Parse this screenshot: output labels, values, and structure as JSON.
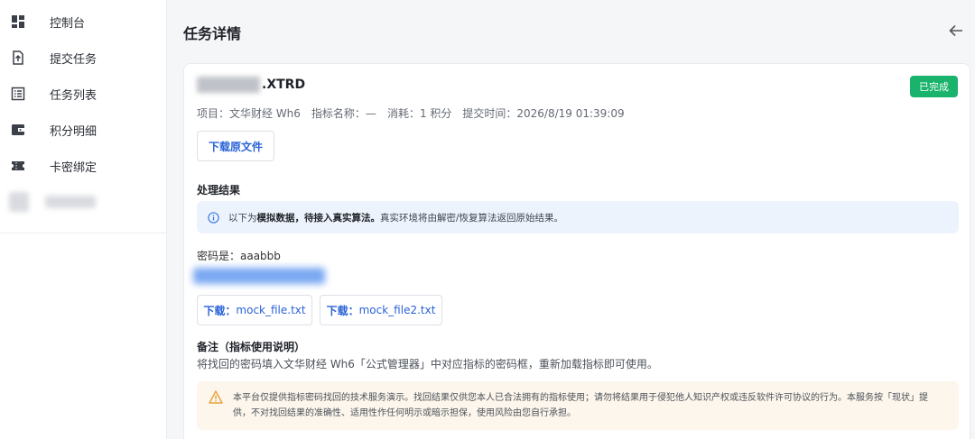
{
  "sidebar": {
    "items": [
      {
        "label": "控制台",
        "icon": "dashboard-icon"
      },
      {
        "label": "提交任务",
        "icon": "upload-file-icon"
      },
      {
        "label": "任务列表",
        "icon": "list-icon"
      },
      {
        "label": "积分明细",
        "icon": "wallet-icon"
      },
      {
        "label": "卡密绑定",
        "icon": "ticket-icon"
      }
    ]
  },
  "header": {
    "title": "任务详情",
    "back_icon": "arrow-left-icon"
  },
  "task": {
    "file_ext": ".XTRD",
    "status": "已完成",
    "meta": {
      "project": "项目：文华财经 Wh6",
      "indicator": "指标名称：—",
      "cost": "消耗：1 积分",
      "submit_time": "提交时间：2026/8/19 01:39:09"
    },
    "download_original": "下载原文件"
  },
  "result": {
    "title": "处理结果",
    "info": {
      "prefix": "以下为 ",
      "bold": "模拟数据，待接入真实算法。",
      "rest": "真实环境将由解密/恢复算法返回原始结果。"
    },
    "password_line": "密码是：aaabbb",
    "downloads": [
      {
        "prefix": "下载：",
        "file": "mock_file.txt"
      },
      {
        "prefix": "下载：",
        "file": "mock_file2.txt"
      }
    ]
  },
  "note": {
    "title": "备注（指标使用说明）",
    "body": "将找回的密码填入文华财经 Wh6「公式管理器」中对应指标的密码框，重新加载指标即可使用。"
  },
  "disclaimer": {
    "line1": "本平台仅提供指标密码找回的技术服务演示。找回结果仅供您本人已合法拥有的指标使用；请勿将结果用于侵犯他人知识产权或违反软件许可协议的行为。本服务按「现状」提",
    "line2": "供，不对找回结果的准确性、适用性作任何明示或暗示担保，使用风险由您自行承担。"
  },
  "colors": {
    "accent": "#2a63d6",
    "success": "#19b36b",
    "info_bg": "#edf3fc",
    "warn_bg": "#fdf6ec",
    "warn_icon": "#e6a23c"
  }
}
